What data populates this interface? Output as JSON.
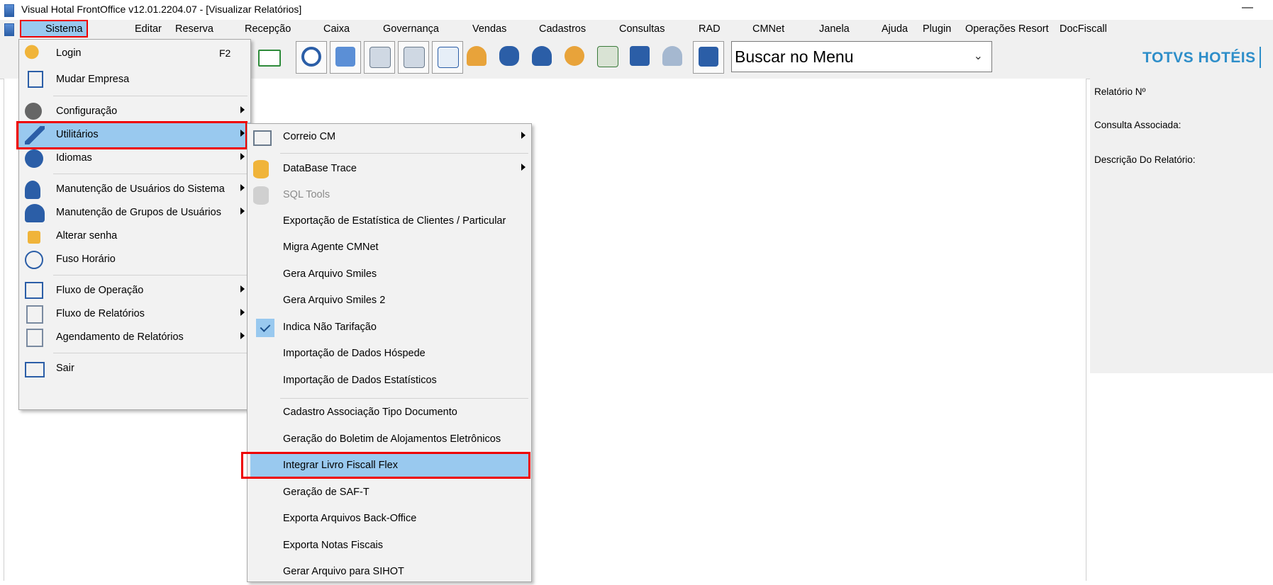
{
  "window": {
    "title": "Visual Hotal FrontOffice v12.01.2204.07 - [Visualizar Relatórios]",
    "minimize": "—"
  },
  "menubar": [
    "Sistema",
    "Editar",
    "Reserva",
    "Recepção",
    "Caixa",
    "Governança",
    "Vendas",
    "Cadastros",
    "Consultas",
    "RAD",
    "CMNet",
    "Janela",
    "Ajuda",
    "Plugin",
    "Operações Resort",
    "DocFiscall"
  ],
  "toolbar": {
    "search_value": "Buscar no Menu",
    "brand": "TOTVS HOTÉIS"
  },
  "right_panel": {
    "relatorio": "Relatório Nº",
    "consulta": "Consulta Associada:",
    "descricao": "Descrição Do Relatório:"
  },
  "sistema_menu": [
    {
      "label": "Login",
      "shortcut": "F2",
      "icon": "key-icon"
    },
    {
      "label": "Mudar Empresa",
      "icon": "building-icon"
    },
    {
      "label": "Configuração",
      "icon": "gear-icon",
      "submenu": true
    },
    {
      "label": "Utilitários",
      "icon": "wrench-icon",
      "submenu": true,
      "highlighted": true
    },
    {
      "label": "Idiomas",
      "icon": "globe-icon",
      "submenu": true
    },
    {
      "label": "Manutenção de Usuários do Sistema",
      "icon": "user-wrench-icon",
      "submenu": true
    },
    {
      "label": "Manutenção de Grupos de Usuários",
      "icon": "users-wrench-icon",
      "submenu": true
    },
    {
      "label": "Alterar senha",
      "icon": "lock-icon"
    },
    {
      "label": "Fuso Horário",
      "icon": "clock-globe-icon"
    },
    {
      "label": "Fluxo de Operação",
      "icon": "flowchart-icon",
      "submenu": true
    },
    {
      "label": "Fluxo de Relatórios",
      "icon": "report-flow-icon",
      "submenu": true
    },
    {
      "label": "Agendamento de Relatórios",
      "icon": "report-schedule-icon",
      "submenu": true
    },
    {
      "label": "Sair",
      "icon": "exit-icon"
    }
  ],
  "utilitarios_menu": [
    {
      "label": "Correio CM",
      "icon": "mail-tray-icon",
      "submenu": true
    },
    {
      "label": "DataBase Trace",
      "icon": "database-icon",
      "submenu": true
    },
    {
      "label": "SQL Tools",
      "icon": "sql-tools-icon",
      "disabled": true
    },
    {
      "label": "Exportação de Estatística de Clientes / Particular"
    },
    {
      "label": "Migra Agente CMNet"
    },
    {
      "label": "Gera Arquivo Smiles"
    },
    {
      "label": "Gera Arquivo Smiles 2"
    },
    {
      "label": "Indica Não Tarifação",
      "checked": true
    },
    {
      "label": "Importação de Dados Hóspede"
    },
    {
      "label": "Importação de Dados Estatísticos"
    },
    {
      "label": "Cadastro Associação Tipo Documento"
    },
    {
      "label": "Geração do Boletim de Alojamentos Eletrônicos"
    },
    {
      "label": "Integrar Livro Fiscall Flex",
      "highlighted": true
    },
    {
      "label": "Geração de SAF-T"
    },
    {
      "label": "Exporta Arquivos Back-Office"
    },
    {
      "label": "Exporta Notas Fiscais"
    },
    {
      "label": "Gerar Arquivo para SIHOT"
    }
  ],
  "colors": {
    "highlight": "#99c9ef",
    "callout": "#e00000",
    "brand": "#2e8ec9"
  }
}
